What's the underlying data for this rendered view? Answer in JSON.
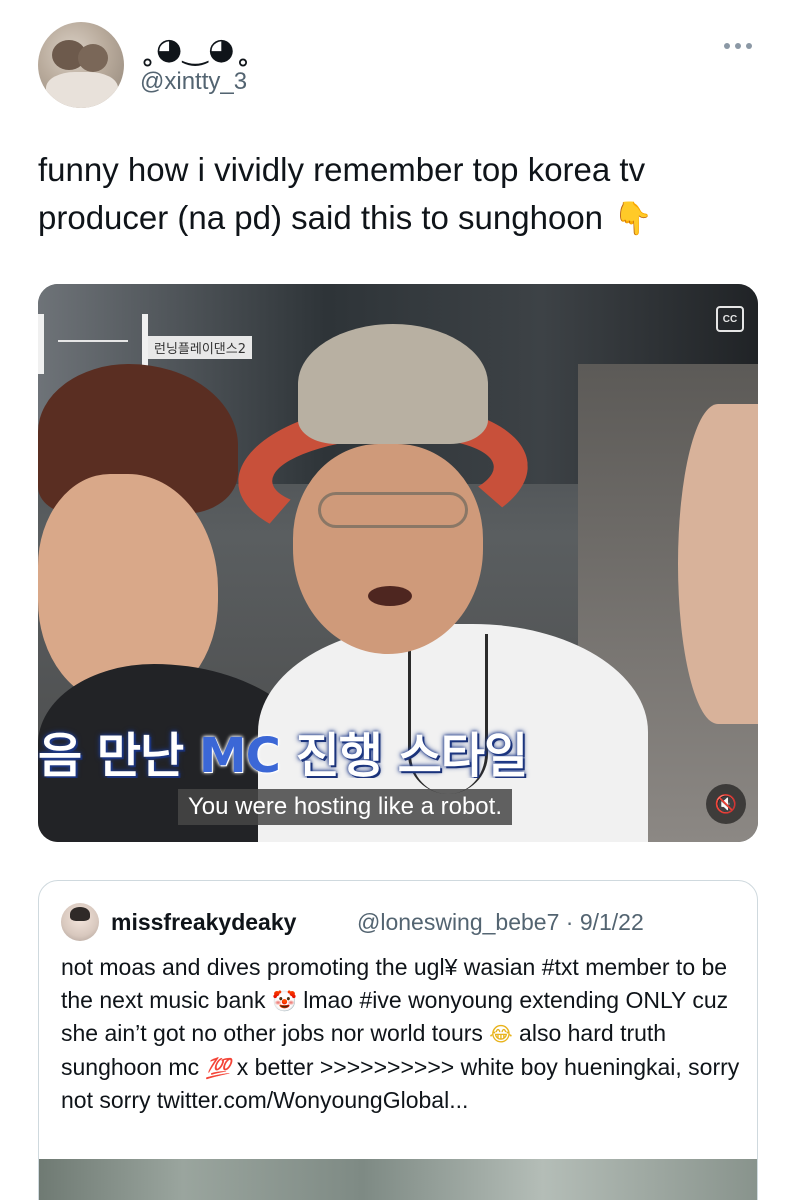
{
  "author": {
    "display_name": "˳◕‿◕˳",
    "handle": "@xintty_3",
    "avatar_icon": "profile-photo"
  },
  "tweet": {
    "text": "funny how i vividly remember top korea tv producer (na pd) said this to sunghoon",
    "emoji": "👇"
  },
  "media": {
    "show_tag": "런닝플레이댄스2",
    "caption_kr_before": "음 만난 ",
    "caption_kr_mc": "MC",
    "caption_kr_after": " 진행 스타일",
    "caption_en": "You were hosting like a robot.",
    "cc_label": "CC",
    "mute_icon": "speaker-muted",
    "mute_glyph": "🔇"
  },
  "quote": {
    "name": "missfreakydeaky",
    "handle_date": "@loneswing_bebe7 · 9/1/22",
    "text_1": "not moas and dives promoting the ugl¥ wasian #txt member to be the next music bank ",
    "emoji_clown": "🤡",
    "text_2": " lmao #ive wonyoung extending ONLY cuz she ain’t got no other jobs nor world tours ",
    "emoji_laugh": "😂",
    "text_3": " also hard truth sunghoon mc ",
    "emoji_100": "💯",
    "text_4": " x better >>>>>>>>>> white boy hueningkai, sorry not sorry twitter.com/WonyoungGlobal..."
  },
  "colors": {
    "text_primary": "#0f1419",
    "text_secondary": "#536471",
    "border": "#cfd9de"
  }
}
